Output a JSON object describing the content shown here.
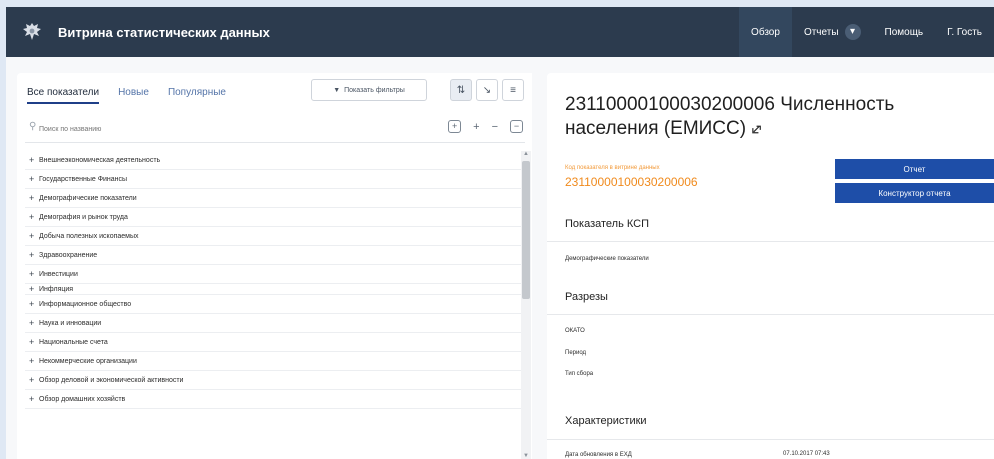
{
  "header": {
    "app_title": "Витрина статистических данных",
    "logo_icon": "eagle-emblem-icon",
    "nav": [
      {
        "label": "Обзор",
        "active": true
      },
      {
        "label": "Отчеты",
        "badge": "▾"
      },
      {
        "label": "Помощь"
      },
      {
        "label": "Г. Гость"
      }
    ]
  },
  "left_panel": {
    "tabs": [
      {
        "label": "Все показатели",
        "active": true
      },
      {
        "label": "Новые"
      },
      {
        "label": "Популярные"
      }
    ],
    "filter_button": "Показать фильтры",
    "search_placeholder": "Поиск по названию",
    "tree_items": [
      "Внешнеэкономическая деятельность",
      "Государственные Финансы",
      "Демографические показатели",
      "Демография и рынок труда",
      "Добыча полезных ископаемых",
      "Здравоохранение",
      "Инвестиции",
      "Инфляция",
      "Информационное общество",
      "Наука и инновации",
      "Национальные счета",
      "Некоммерческие организации",
      "Обзор деловой и экономической активности",
      "Обзор домашних хозяйств"
    ]
  },
  "right_panel": {
    "title": "23110000100030200006 Численность населения (ЕМИСС)",
    "code_label": "Код показателя в витрине данных",
    "code_value": "23110000100030200006",
    "report_button": "Отчет",
    "constructor_button": "Конструктор отчета",
    "ksp_title": "Показатель КСП",
    "ksp_value": "Демографические показатели",
    "sections_title": "Разрезы",
    "sections": [
      "ОКАТО",
      "Период",
      "Тип сбора"
    ],
    "characteristics_title": "Характеристики",
    "update_label": "Дата обновления в ЕХД",
    "update_value": "07.10.2017 07:43"
  },
  "colors": {
    "topbar": "#2c3b4e",
    "accent_blue": "#1e4ea8",
    "accent_orange": "#f08a1c"
  }
}
